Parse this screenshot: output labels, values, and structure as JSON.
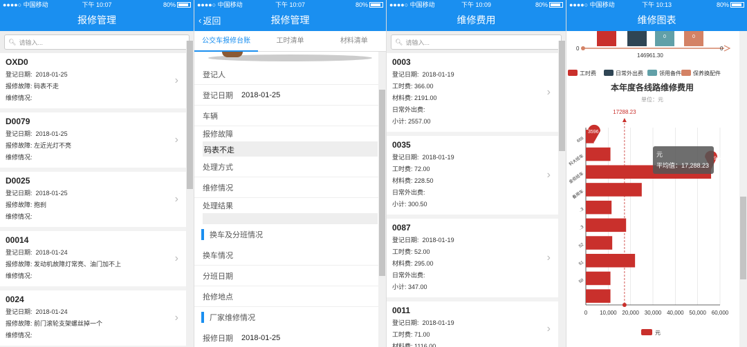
{
  "status": {
    "carrier": "●●●●○ 中国移动",
    "battery": "80%"
  },
  "screen1": {
    "time": "下午 10:07",
    "title": "报修管理",
    "search_placeholder": "请输入...",
    "labels": {
      "date": "登记日期:",
      "fault": "报修故障:",
      "repair": "维修情况:"
    },
    "items": [
      {
        "code": "OXD0",
        "date": "2018-01-25",
        "fault": "码表不走"
      },
      {
        "code": "D0079",
        "date": "2018-01-25",
        "fault": "左近光灯不亮"
      },
      {
        "code": "D0025",
        "date": "2018-01-25",
        "fault": "抱刹"
      },
      {
        "code": "00014",
        "date": "2018-01-24",
        "fault": "发动机故障灯常亮、油门加不上"
      },
      {
        "code": "0024",
        "date": "2018-01-24",
        "fault": "前门滚轮支架螺丝掉一个"
      }
    ]
  },
  "screen2": {
    "time": "下午 10:07",
    "back": "返回",
    "title": "报修管理",
    "tabs": [
      "公交车报修台账",
      "工时清单",
      "材料清单"
    ],
    "fields": {
      "registrar": "登记人",
      "reg_date": "登记日期",
      "reg_date_value": "2018-01-25",
      "vehicle": "车辆",
      "fault": "报修故障",
      "fault_value": "码表不走",
      "method": "处理方式",
      "repair": "维修情况",
      "result": "处理结果"
    },
    "section1": "换车及分班情况",
    "section1_fields": [
      "换车情况",
      "分班日期",
      "抢修地点"
    ],
    "section2": "厂家维修情况",
    "section2_field": "报修日期",
    "section2_value": "2018-01-25"
  },
  "screen3": {
    "time": "下午 10:09",
    "title": "维修费用",
    "search_placeholder": "请输入...",
    "labels": {
      "date": "登记日期:",
      "labor": "工时费:",
      "material": "材料费:",
      "extra": "日常外出费:",
      "subtotal": "小计:"
    },
    "items": [
      {
        "code": "0003",
        "date": "2018-01-19",
        "labor": "366.00",
        "material": "2191.00",
        "extra": "",
        "subtotal": "2557.00"
      },
      {
        "code": "0035",
        "date": "2018-01-19",
        "labor": "72.00",
        "material": "228.50",
        "extra": "",
        "subtotal": "300.50"
      },
      {
        "code": "0087",
        "date": "2018-01-19",
        "labor": "52.00",
        "material": "295.00",
        "extra": "",
        "subtotal": "347.00"
      },
      {
        "code": "0011",
        "date": "2018-01-19",
        "labor": "71.00",
        "material": "1116.00"
      }
    ]
  },
  "screen4": {
    "time": "下午 10:13",
    "title": "维修图表",
    "top_zero": "0",
    "top_value": "146961.30",
    "top_legend": [
      {
        "name": "工时费",
        "color": "#c9302c"
      },
      {
        "name": "日常外出费",
        "color": "#2f4554"
      },
      {
        "name": "领用备件",
        "color": "#61a0a8"
      },
      {
        "name": "保养换配件",
        "color": "#d48265"
      }
    ],
    "chart_title": "本年度各线路维修费用",
    "unit": "单位：元",
    "markline_value": "17288.23",
    "tooltip_title": "元",
    "tooltip_text": "平均值：17,288.23",
    "max_label": "3596",
    "edge_label": "9.5",
    "legend_label": "元",
    "bar_color": "#c9302c"
  },
  "chart_data": {
    "type": "bar",
    "orientation": "horizontal",
    "title": "本年度各线路维修费用",
    "subtitle": "单位：元",
    "categories": [
      "655",
      "科大班车",
      "金佰班车",
      "备用车",
      "..3",
      "..3",
      "52",
      "51",
      "50",
      ""
    ],
    "series": [
      {
        "name": "元",
        "values": [
          3596,
          11000,
          56000,
          25000,
          11500,
          18000,
          11800,
          22000,
          11000,
          11000
        ]
      }
    ],
    "mark_line": {
      "name": "平均值",
      "value": 17288.23
    },
    "xlim": [
      0,
      60000
    ],
    "xticks": [
      "0",
      "10,000",
      "20,000",
      "30,000",
      "40,000",
      "50,000",
      "60,000"
    ],
    "grid": true,
    "legend": "bottom"
  }
}
